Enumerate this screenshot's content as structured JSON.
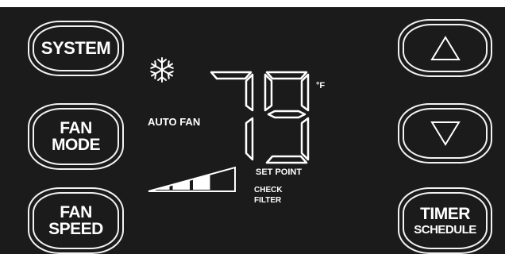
{
  "buttons": {
    "system": "SYSTEM",
    "fan_mode_line1": "FAN",
    "fan_mode_line2": "MODE",
    "fan_speed_line1": "FAN",
    "fan_speed_line2": "SPEED",
    "up": "up-arrow",
    "down": "down-arrow",
    "timer_line1": "TIMER",
    "timer_line2": "SCHEDULE"
  },
  "display": {
    "mode_icon": "snowflake-icon",
    "fan_status": "AUTO FAN",
    "temperature": "79",
    "unit": "°F",
    "set_point_label": "SET POINT",
    "check_filter_line1": "CHECK",
    "check_filter_line2": "FILTER",
    "fan_speed_level": 3,
    "fan_speed_levels_total": 4
  },
  "colors": {
    "panel": "#1b1b1b",
    "foreground": "#ffffff"
  }
}
